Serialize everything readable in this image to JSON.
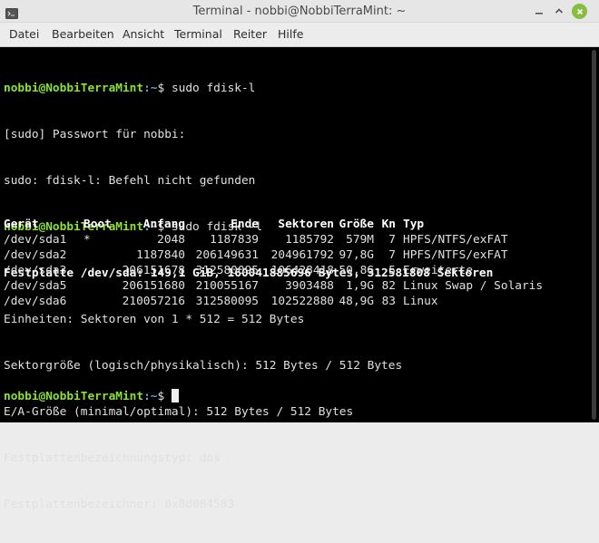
{
  "window": {
    "title": "Terminal - nobbi@NobbiTerraMint: ~"
  },
  "menu": [
    "Datei",
    "Bearbeiten",
    "Ansicht",
    "Terminal",
    "Reiter",
    "Hilfe"
  ],
  "prompt": {
    "user_host": "nobbi@NobbiTerraMint",
    "path": ":~",
    "symbol": "$ "
  },
  "lines": {
    "cmd1": "sudo fdisk-l",
    "l2": "[sudo] Passwort für nobbi:",
    "l3": "sudo: fdisk-l: Befehl nicht gefunden",
    "cmd2": "sudo fdisk -l",
    "l5": "Festplatte /dev/sda: 149,1 GiB, 160041885696 Bytes, 312581808 Sektoren",
    "l6": "Einheiten: Sektoren von 1 * 512 = 512 Bytes",
    "l7": "Sektorgröße (logisch/physikalisch): 512 Bytes / 512 Bytes",
    "l8": "E/A-Größe (minimal/optimal): 512 Bytes / 512 Bytes",
    "l9": "Festplattenbezeichnungstyp: dos",
    "l10": "Festplattenbezeichner: 0x8d084583"
  },
  "table": {
    "headers": {
      "device": "Gerät",
      "boot": "Boot",
      "start": "Anfang",
      "end": "Ende",
      "sectors": "Sektoren",
      "size": "Größe",
      "id": "Kn",
      "type": "Typ"
    },
    "rows": [
      {
        "device": "/dev/sda1",
        "boot": "*",
        "start": "2048",
        "end": "1187839",
        "sectors": "1185792",
        "size": "579M",
        "id": "7",
        "type": "HPFS/NTFS/exFAT"
      },
      {
        "device": "/dev/sda2",
        "boot": "",
        "start": "1187840",
        "end": "206149631",
        "sectors": "204961792",
        "size": "97,8G",
        "id": "7",
        "type": "HPFS/NTFS/exFAT"
      },
      {
        "device": "/dev/sda3",
        "boot": "",
        "start": "206151678",
        "end": "312580095",
        "sectors": "106428418",
        "size": "50,8G",
        "id": "5",
        "type": "Erweiterte"
      },
      {
        "device": "/dev/sda5",
        "boot": "",
        "start": "206151680",
        "end": "210055167",
        "sectors": "3903488",
        "size": "1,9G",
        "id": "82",
        "type": "Linux Swap / Solaris"
      },
      {
        "device": "/dev/sda6",
        "boot": "",
        "start": "210057216",
        "end": "312580095",
        "sectors": "102522880",
        "size": "48,9G",
        "id": "83",
        "type": "Linux"
      }
    ]
  },
  "colors": {
    "prompt_user": "#8ae234",
    "prompt_path": "#729fcf",
    "close_button": "#86be43"
  },
  "icons": [
    "terminal-icon",
    "minimize-icon",
    "maximize-icon",
    "close-icon"
  ]
}
